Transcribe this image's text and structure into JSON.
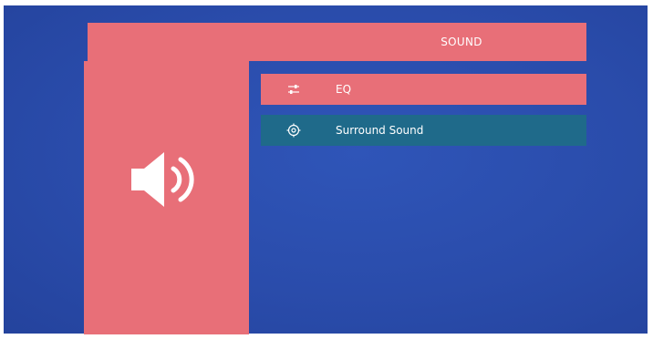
{
  "header": {
    "title": "SOUND"
  },
  "side_panel": {
    "icon": "speaker-volume-icon"
  },
  "menu": {
    "items": [
      {
        "label": "EQ",
        "icon": "equalizer-icon",
        "state": "normal"
      },
      {
        "label": "Surround Sound",
        "icon": "surround-sound-icon",
        "state": "selected"
      }
    ]
  },
  "colors": {
    "background": "#2a4cab",
    "panel": "#e86f78",
    "selected_item": "#1f6a8a",
    "text": "#ffffff"
  }
}
